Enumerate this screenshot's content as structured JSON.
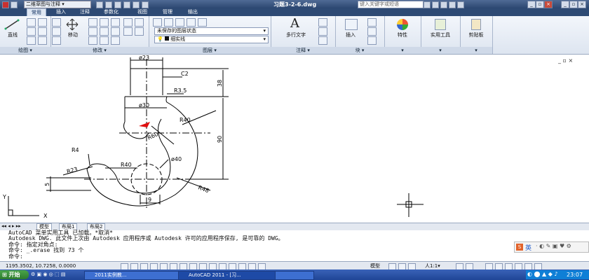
{
  "titlebar": {
    "workspace": "二维草图与注释",
    "document_title": "习题3-2-6.dwg",
    "search_placeholder": "键入关键字或短语"
  },
  "ribbon_tabs": [
    "常用",
    "插入",
    "注释",
    "参数化",
    "视图",
    "管理",
    "输出"
  ],
  "ribbon": {
    "draw_line": "直线",
    "draw_panel": "绘图",
    "modify_move": "移动",
    "modify_panel": "修改",
    "layer_state": "未保存的图层状态",
    "layer_current": "细实线",
    "layer_panel": "图层",
    "mtext": "多行文字",
    "annotation_panel": "注释",
    "insert": "插入",
    "block_panel": "块",
    "properties": "特性",
    "utilities": "实用工具",
    "clipboard": "剪贴板"
  },
  "drawing": {
    "dims": {
      "top_dia": "ø23",
      "chamfer": "C2",
      "r35": "R3.5",
      "v38": "38",
      "shank_dia": "ø30",
      "r40_top": "R40",
      "r60": "R60",
      "v90": "90",
      "r4": "R4",
      "r23": "R23",
      "r40_mid": "R40",
      "dia40": "ø40",
      "v5": "5",
      "r48": "R48",
      "h9": "9"
    },
    "ucs_x": "X",
    "ucs_y": "Y"
  },
  "layout_tabs": [
    "模型",
    "布局1",
    "布局2"
  ],
  "command_lines": [
    "AutoCAD 菜单实用工具 已加载。*取消*",
    "Autodesk DWG.  此文件上次由 Autodesk 应用程序或 Autodesk 许可的应用程序保存, 是可靠的 DWG。",
    "命令: 指定对角点:",
    "命令: _.erase 找到 73 个",
    "命令:"
  ],
  "ime": {
    "label": "英"
  },
  "status": {
    "coords": "1195.3502, 10.7258, 0.0000",
    "model": "模型",
    "annotation_scale": "人1:1▾"
  },
  "taskbar": {
    "start": "开始",
    "tasks": [
      "2011实例教...",
      "AutoCAD 2011 - [习...",
      ""
    ],
    "clock": "23:07"
  },
  "colors": {
    "title_bg": "#2b4670",
    "tab_bg": "#2e4a74",
    "ribbon_bg": "#e6ecf5",
    "taskbar_bg": "#2450a6",
    "start_green": "#2c7a2c",
    "marker_red": "#e01010"
  }
}
